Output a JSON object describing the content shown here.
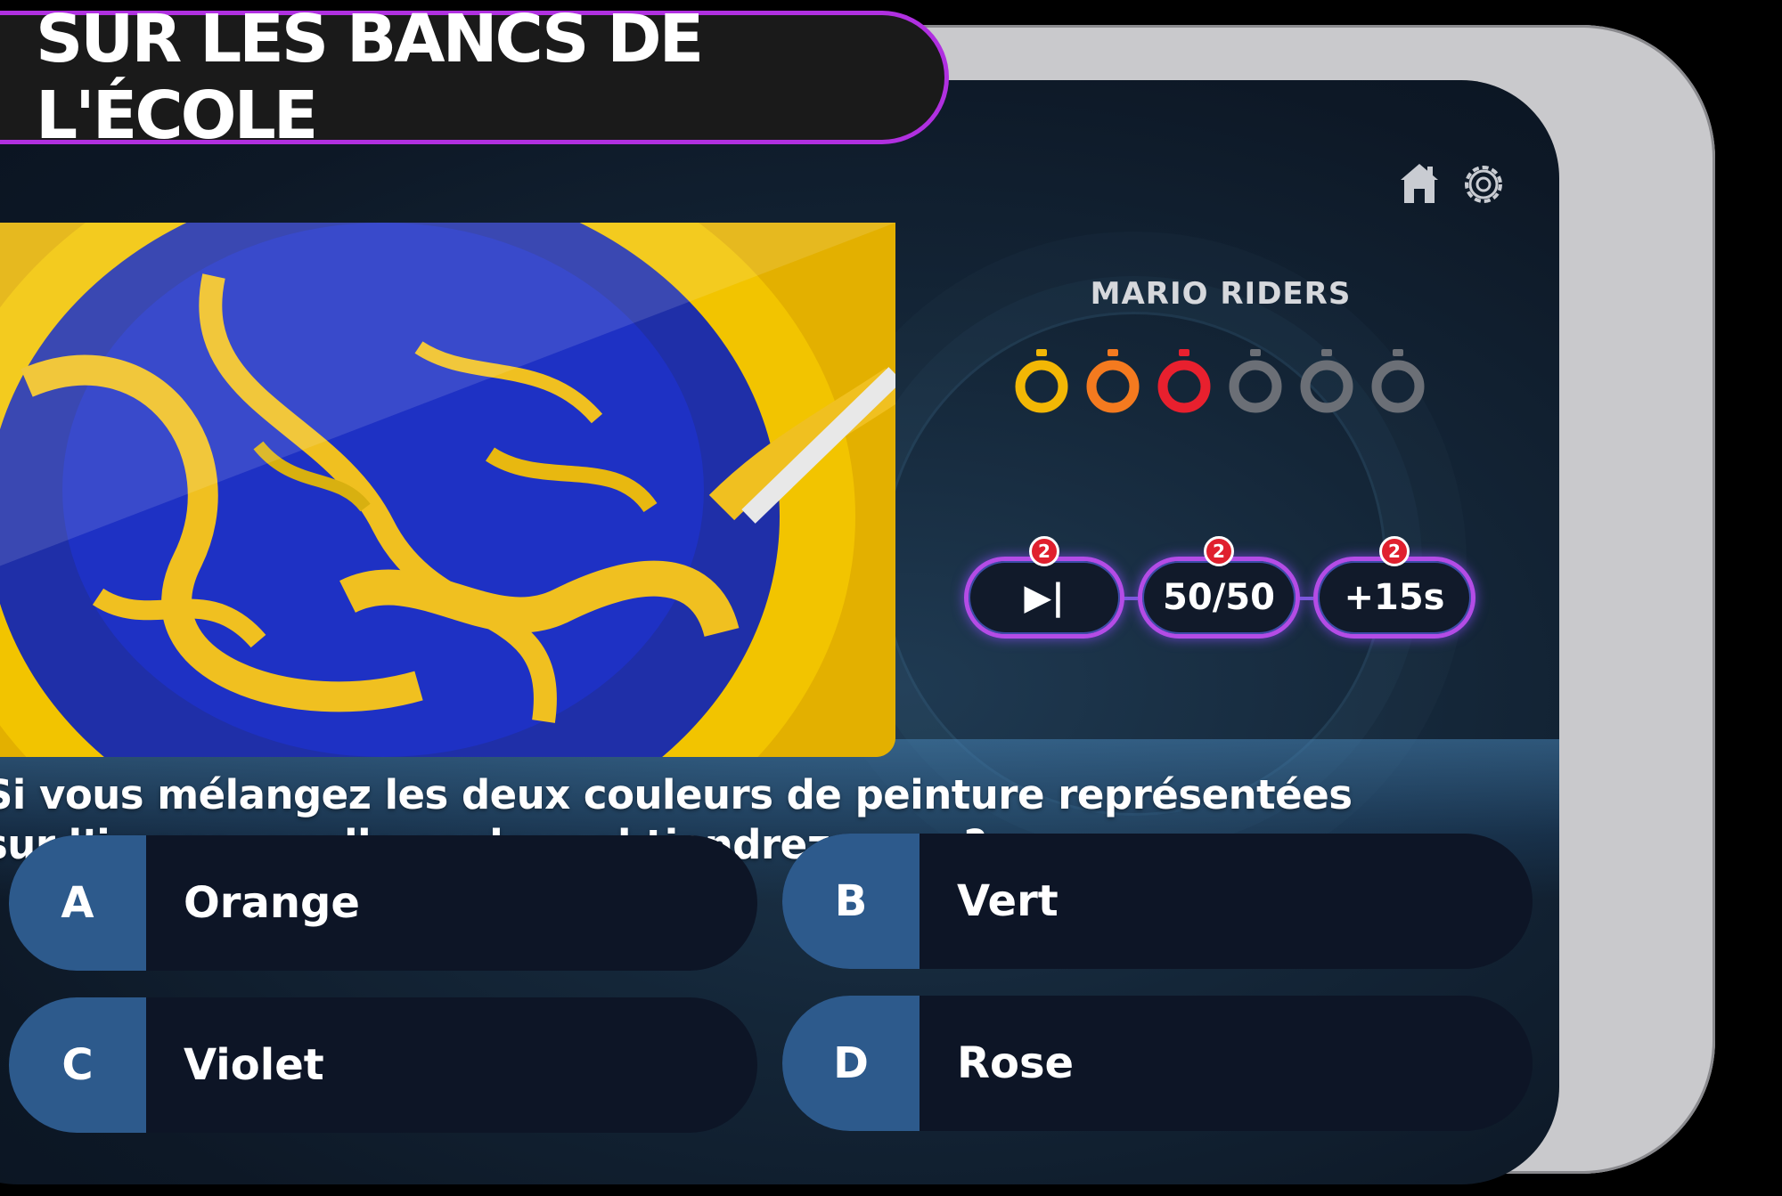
{
  "title_banner": "SUR LES BANCS DE L'ÉCOLE",
  "header": {
    "home_icon": "home-icon",
    "settings_icon": "gear-icon"
  },
  "team_name": "MARIO RIDERS",
  "timers": [
    {
      "color": "#f2b705",
      "active": true
    },
    {
      "color": "#f47a1f",
      "active": true
    },
    {
      "color": "#e8202e",
      "active": true
    },
    {
      "color": "#6b6f76",
      "active": false
    },
    {
      "color": "#6b6f76",
      "active": false
    },
    {
      "color": "#6b6f76",
      "active": false
    }
  ],
  "powerups": [
    {
      "label": "▶|",
      "count": "2",
      "icon": "skip-icon"
    },
    {
      "label": "50/50",
      "count": "2"
    },
    {
      "label": "+15s",
      "count": "2"
    }
  ],
  "question": "Si vous mélangez les deux couleurs de peinture représentées sur l’image, quelle couleur obtiendrez-vous ?",
  "answers": [
    {
      "letter": "A",
      "text": "Orange"
    },
    {
      "letter": "B",
      "text": "Vert"
    },
    {
      "letter": "C",
      "text": "Violet"
    },
    {
      "letter": "D",
      "text": "Rose"
    }
  ],
  "colors": {
    "accent": "#b030e0",
    "answer_letter_bg": "#2d5a8c",
    "answer_bg": "#0d1526"
  }
}
